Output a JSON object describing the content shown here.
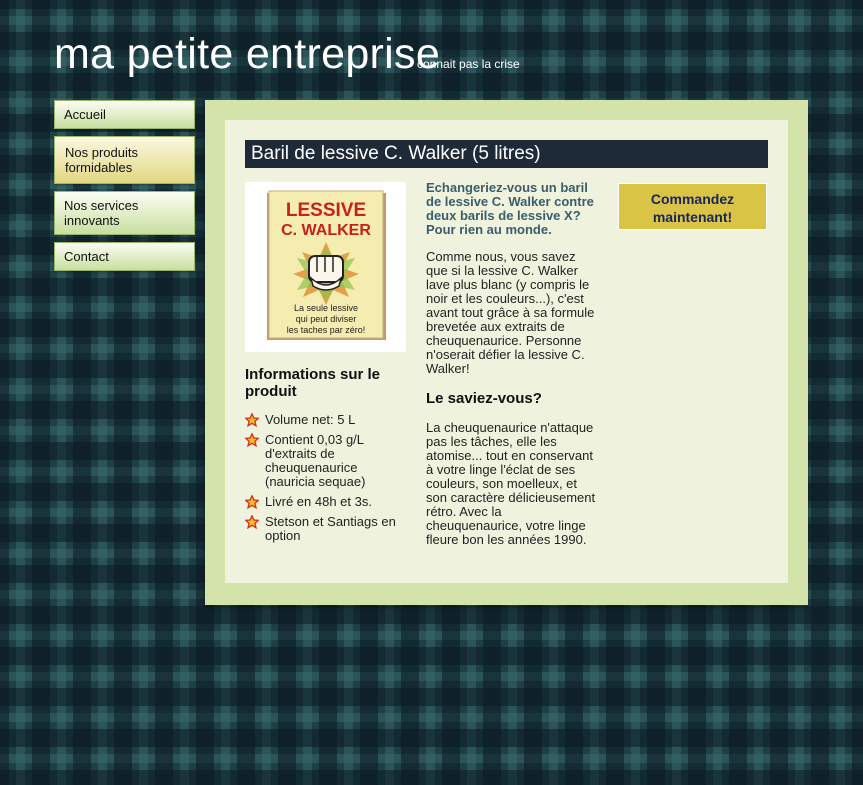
{
  "header": {
    "title": "ma petite entreprise",
    "tagline": "connait pas la crise"
  },
  "nav": {
    "items": [
      {
        "label": "Accueil"
      },
      {
        "label": "Nos produits formidables",
        "active": true
      },
      {
        "label": "Nos services innovants"
      },
      {
        "label": "Contact"
      }
    ]
  },
  "product": {
    "title": "Baril de lessive C. Walker (5 litres)",
    "image": {
      "brand_line1": "LESSIVE",
      "brand_line2": "C. WALKER",
      "slogan_line1": "La seule lessive",
      "slogan_line2": "qui peut diviser",
      "slogan_line3": "les taches par zéro!"
    },
    "info_heading": "Informations sur le produit",
    "info_items": [
      "Volume net: 5 L",
      "Contient 0,03 g/L d'extraits de cheuquenaurice (nauricia sequae)",
      "Livré en 48h et 3s.",
      "Stetson et Santiags en option"
    ],
    "lead": "Echangeriez-vous un baril de lessive C. Walker contre deux barils de lessive X? Pour rien au monde.",
    "body": "Comme nous, vous savez que si la lessive C. Walker lave plus blanc (y compris le noir et les couleurs...), c'est avant tout grâce à sa formule brevetée aux extraits de cheuquenaurice. Personne n'oserait défier la lessive C. Walker!",
    "subheading": "Le saviez-vous?",
    "body2": "La cheuquenaurice n'attaque pas les tâches, elle les atomise... tout en conservant à votre linge l'éclat de ses couleurs, son moelleux, et son caractère délicieusement rétro. Avec la cheuquenaurice, votre linge fleure bon les années 1990.",
    "order_button": "Commandez maintenant!"
  },
  "colors": {
    "accent_title_bar": "#1f2a38",
    "order_button": "#d9c446",
    "panel": "#d3e3a9",
    "lead_text": "#3b5d6a"
  }
}
